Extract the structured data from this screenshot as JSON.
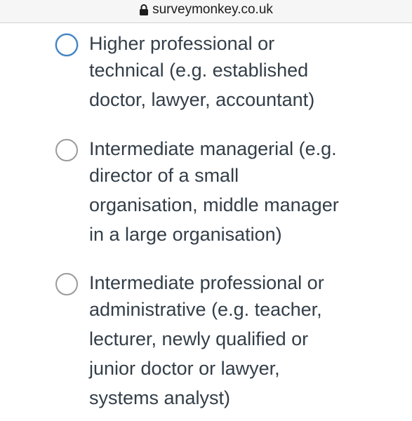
{
  "browser": {
    "url": "surveymonkey.co.uk"
  },
  "options": [
    {
      "lines": [
        "Higher professional or",
        "technical (e.g. established",
        "doctor, lawyer, accountant)"
      ],
      "selected": false,
      "focused": true
    },
    {
      "lines": [
        "Intermediate managerial (e.g.",
        "director of a small",
        "organisation, middle manager",
        "in a large organisation)"
      ],
      "selected": false,
      "focused": false
    },
    {
      "lines": [
        "Intermediate professional or",
        "administrative (e.g. teacher,",
        "lecturer, newly qualified or",
        "junior doctor or lawyer,",
        "systems analyst)"
      ],
      "selected": false,
      "focused": false
    }
  ]
}
